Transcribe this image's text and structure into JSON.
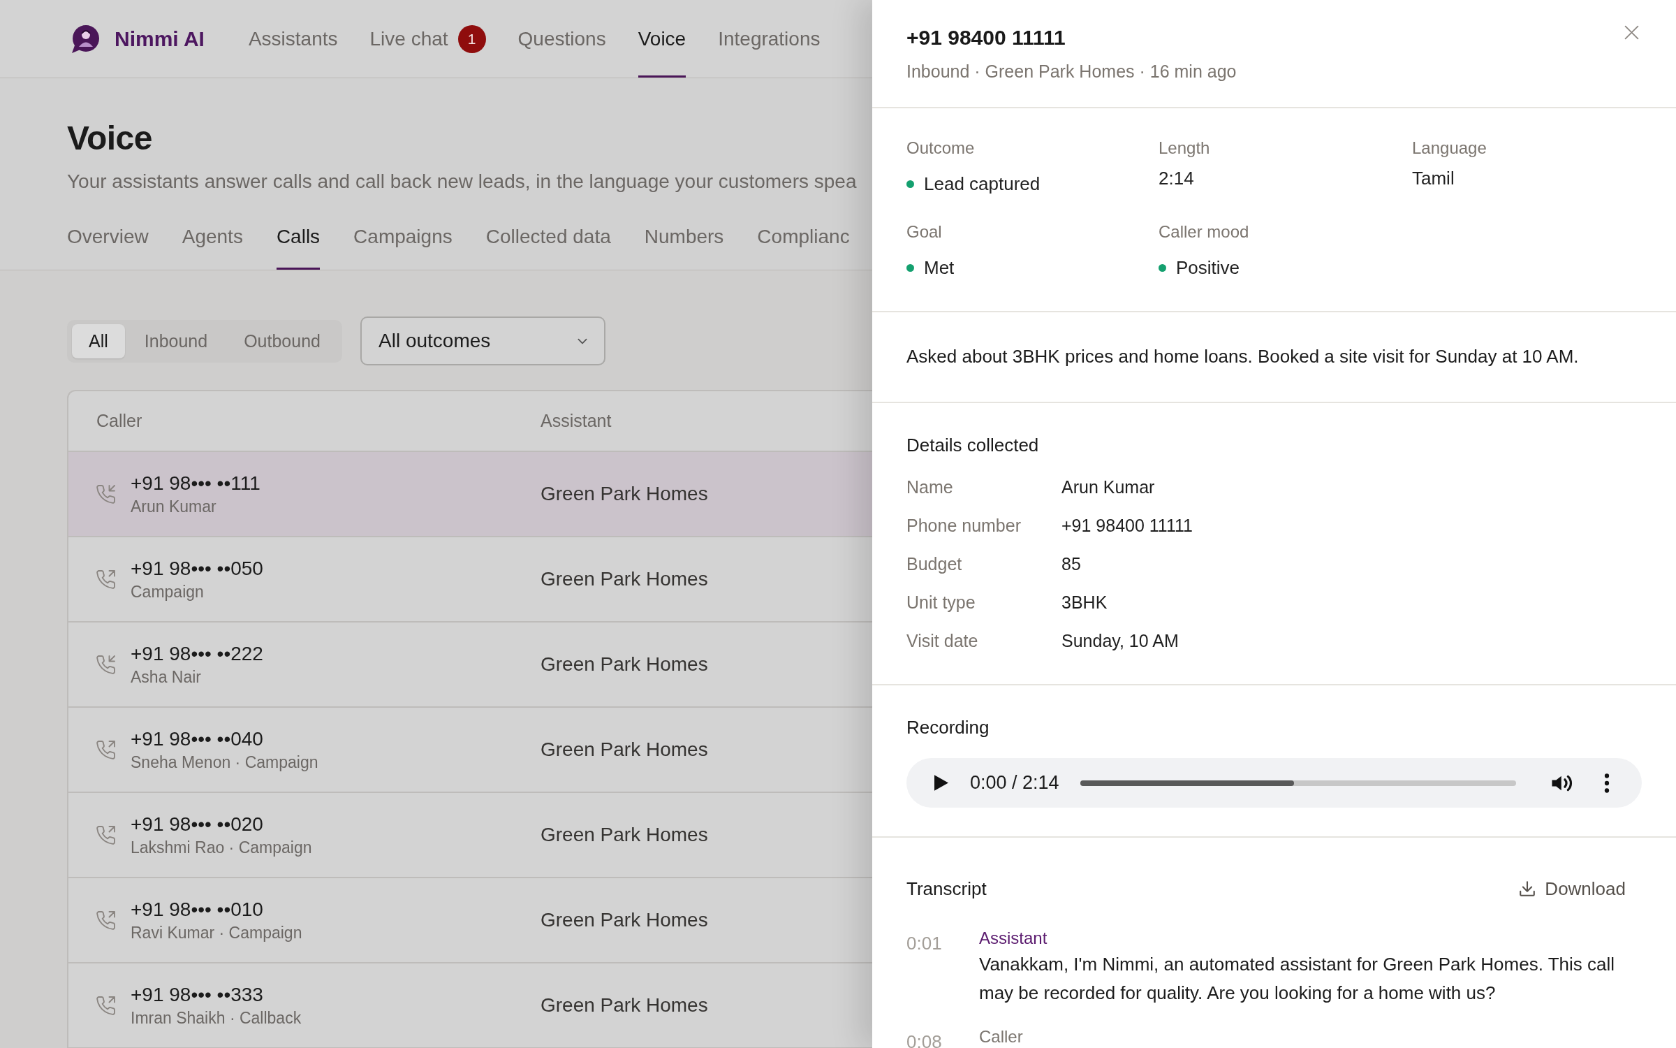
{
  "app": {
    "brand": "Nimmi AI"
  },
  "nav": [
    {
      "label": "Assistants",
      "selected": false
    },
    {
      "label": "Live chat",
      "selected": false,
      "badge": "1"
    },
    {
      "label": "Questions",
      "selected": false
    },
    {
      "label": "Voice",
      "selected": true
    },
    {
      "label": "Integrations",
      "selected": false
    }
  ],
  "page": {
    "title": "Voice",
    "subtitle": "Your assistants answer calls and call back new leads, in the language your customers spea"
  },
  "tabs": [
    {
      "label": "Overview",
      "selected": false
    },
    {
      "label": "Agents",
      "selected": false
    },
    {
      "label": "Calls",
      "selected": true
    },
    {
      "label": "Campaigns",
      "selected": false
    },
    {
      "label": "Collected data",
      "selected": false
    },
    {
      "label": "Numbers",
      "selected": false
    },
    {
      "label": "Complianc",
      "selected": false
    }
  ],
  "filters": {
    "direction": [
      {
        "label": "All",
        "selected": true
      },
      {
        "label": "Inbound",
        "selected": false
      },
      {
        "label": "Outbound",
        "selected": false
      }
    ],
    "outcome_dropdown": {
      "value": "All outcomes"
    }
  },
  "table": {
    "columns": [
      "Caller",
      "Assistant"
    ],
    "rows": [
      {
        "kind": "inbound",
        "number": "+91 98••• ••111",
        "detail": "Arun Kumar",
        "assistant": "Green Park Homes",
        "selected": true
      },
      {
        "kind": "outbound",
        "number": "+91 98••• ••050",
        "detail": "Campaign",
        "assistant": "Green Park Homes",
        "selected": false
      },
      {
        "kind": "inbound",
        "number": "+91 98••• ••222",
        "detail": "Asha Nair",
        "assistant": "Green Park Homes",
        "selected": false
      },
      {
        "kind": "outbound",
        "number": "+91 98••• ••040",
        "detail": "Sneha Menon · Campaign",
        "assistant": "Green Park Homes",
        "selected": false
      },
      {
        "kind": "outbound",
        "number": "+91 98••• ••020",
        "detail": "Lakshmi Rao · Campaign",
        "assistant": "Green Park Homes",
        "selected": false
      },
      {
        "kind": "outbound",
        "number": "+91 98••• ••010",
        "detail": "Ravi Kumar · Campaign",
        "assistant": "Green Park Homes",
        "selected": false
      },
      {
        "kind": "outbound",
        "number": "+91 98••• ••333",
        "detail": "Imran Shaikh · Callback",
        "assistant": "Green Park Homes",
        "selected": false
      }
    ]
  },
  "call_panel": {
    "title": "+91 98400 11111",
    "meta": "Inbound · Green Park Homes · 16 min ago",
    "stats": [
      {
        "label": "Outcome",
        "value": "Lead captured",
        "color": "#14a06f"
      },
      {
        "label": "Length",
        "value": "2:14"
      },
      {
        "label": "Language",
        "value": "Tamil"
      },
      {
        "label": "Goal",
        "value": "Met",
        "color": "#14a06f"
      },
      {
        "label": "Caller mood",
        "value": "Positive",
        "color": "#14a06f"
      }
    ],
    "summary": "Asked about 3BHK prices and home loans. Booked a site visit for Sunday at 10 AM.",
    "details": {
      "heading": "Details collected",
      "fields": [
        {
          "label": "Name",
          "value": "Arun Kumar"
        },
        {
          "label": "Phone number",
          "value": "+91 98400 11111"
        },
        {
          "label": "Budget",
          "value": "85"
        },
        {
          "label": "Unit type",
          "value": "3BHK"
        },
        {
          "label": "Visit date",
          "value": "Sunday, 10 AM"
        }
      ]
    },
    "recording": {
      "heading": "Recording",
      "time": "0:00 / 2:14",
      "level": 0.49
    },
    "transcript": {
      "heading": "Transcript",
      "download": "Download",
      "entries": [
        {
          "time": "0:01",
          "speaker": "Assistant",
          "kind": "assistant",
          "text": "Vanakkam, I'm Nimmi, an automated assistant for Green Park Homes. This call may be recorded for quality. Are you looking for a home with us?"
        },
        {
          "time": "0:08",
          "speaker": "Caller",
          "kind": "caller"
        }
      ]
    }
  }
}
